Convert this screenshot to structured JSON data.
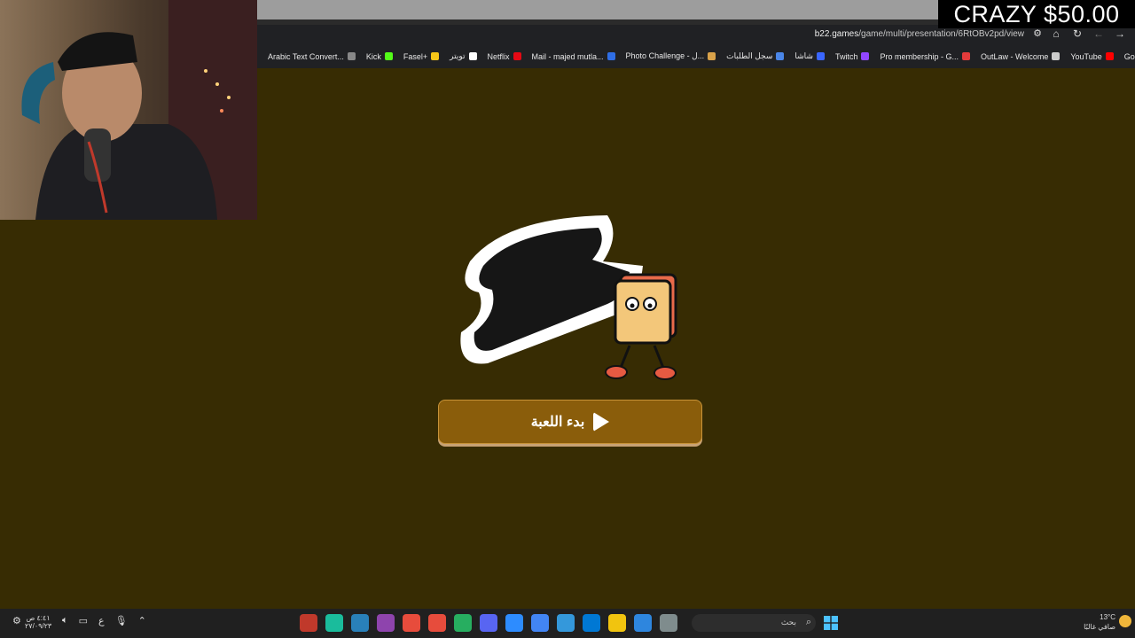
{
  "overlay": {
    "donation_text": "CRAZY $50.00"
  },
  "browser": {
    "url_domain": "b22.games",
    "url_path": "/game/multi/presentation/6RtOBv2pd/view",
    "bookmarks": [
      {
        "label": "Arabic Text Convert...",
        "color": "#888888"
      },
      {
        "label": "Kick",
        "color": "#53fc18"
      },
      {
        "label": "Fasel+",
        "color": "#f5c518"
      },
      {
        "label": "تويتر",
        "color": "#ffffff"
      },
      {
        "label": "Netflix",
        "color": "#e50914"
      },
      {
        "label": "Mail - majed mutla...",
        "color": "#2f6ee6"
      },
      {
        "label": "Photo Challenge - ل...",
        "color": "#d9a24a"
      },
      {
        "label": "سجل الطلبات",
        "color": "#4a86e8"
      },
      {
        "label": "شاشا",
        "color": "#3a66ff"
      },
      {
        "label": "Twitch",
        "color": "#9146ff"
      },
      {
        "label": "Pro membership - G...",
        "color": "#e23b3b"
      },
      {
        "label": "OutLaw - Welcome",
        "color": "#cccccc"
      },
      {
        "label": "YouTube",
        "color": "#ff0000"
      },
      {
        "label": "Google",
        "color": "#4285f4"
      }
    ]
  },
  "game": {
    "logo_alt": "تحدي الصور",
    "start_button_label": "بدء اللعبة"
  },
  "taskbar": {
    "time": "٤:٤١ ص",
    "date": "٢٧/٠٩/٢٣",
    "lang": "ع",
    "search_placeholder": "بحث",
    "temp": "13°C",
    "weather_desc": "صافي غالبًا",
    "app_colors": [
      "#c0392b",
      "#1abc9c",
      "#2980b9",
      "#8e44ad",
      "#e74c3c",
      "#e74c3c",
      "#27ae60",
      "#5865f2",
      "#2d8cff",
      "#4285f4",
      "#3498db",
      "#0078d4",
      "#f1c40f",
      "#2e86de",
      "#7f8c8d"
    ]
  }
}
